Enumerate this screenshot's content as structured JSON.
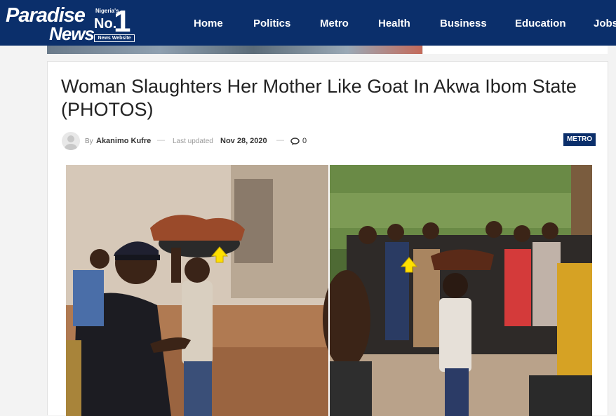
{
  "brand": {
    "name_line1": "Paradise",
    "name_line2": "News",
    "badge_small": "Nigeria's",
    "badge_no": "No.",
    "badge_one": "1",
    "badge_caption": "News Website",
    "header_color": "#0b2f6b"
  },
  "nav": {
    "items": [
      {
        "label": "Home"
      },
      {
        "label": "Politics"
      },
      {
        "label": "Metro"
      },
      {
        "label": "Health"
      },
      {
        "label": "Business"
      },
      {
        "label": "Education"
      },
      {
        "label": "Jobs"
      }
    ]
  },
  "article": {
    "title": "Woman Slaughters Her Mother Like Goat In Akwa Ibom State (PHOTOS)",
    "by_label": "By",
    "author": "Akanimo Kufre",
    "updated_label": "Last updated",
    "date": "Nov 28, 2020",
    "comments_icon": "comment-icon",
    "comments_count": "0",
    "category": "METRO",
    "separator": "—"
  }
}
